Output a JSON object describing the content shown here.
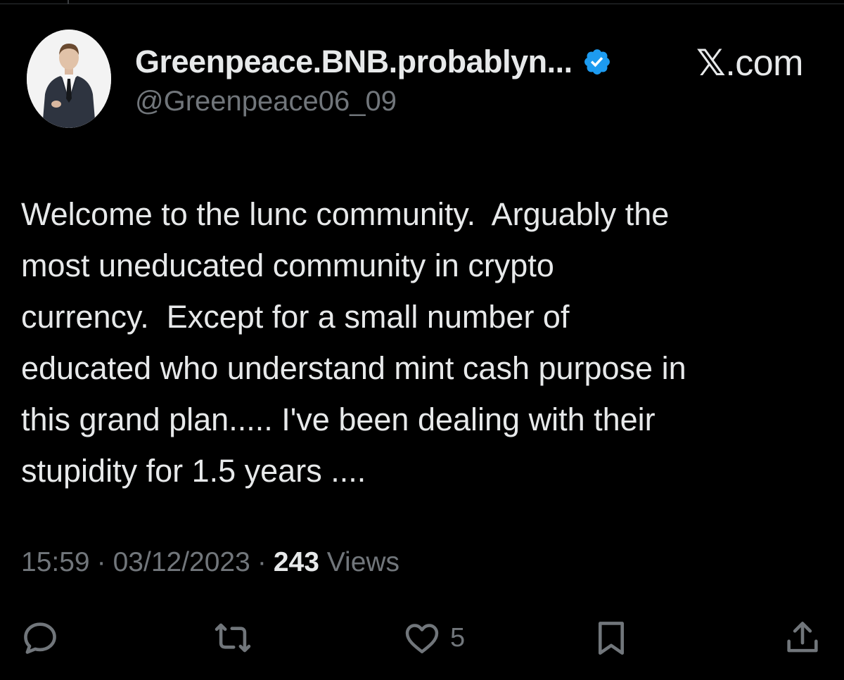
{
  "header": {
    "display_name": "Greenpeace.BNB.probablyn...",
    "handle": "@Greenpeace06_09",
    "site_label_x": "𝕏",
    "site_label_rest": ".com"
  },
  "tweet": {
    "text": "Welcome to the lunc community.  Arguably the\nmost uneducated community in crypto\ncurrency.  Except for a small number of\neducated who understand mint cash purpose in\nthis grand plan..... I've been dealing with their\nstupidity for 1.5 years ...."
  },
  "meta": {
    "time": "15:59",
    "separator": "·",
    "date": "03/12/2023",
    "views_count": "243",
    "views_label": "Views"
  },
  "actions": {
    "reply_icon": "reply-icon",
    "retweet_icon": "retweet-icon",
    "like_icon": "heart-icon",
    "like_count": "5",
    "bookmark_icon": "bookmark-icon",
    "share_icon": "share-icon"
  },
  "colors": {
    "background": "#000000",
    "text_primary": "#e7e9ea",
    "text_secondary": "#71767b",
    "verified_blue": "#1d9bf0"
  }
}
